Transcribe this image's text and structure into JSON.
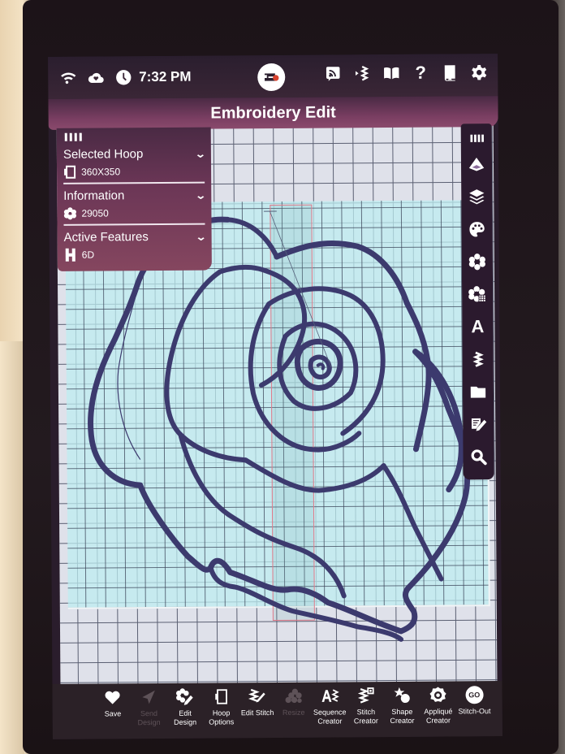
{
  "status_bar": {
    "time": "7:32 PM",
    "left_icons": [
      "wifi-icon",
      "cloud-heart-icon",
      "clock-icon"
    ],
    "center_icon": "sewing-machine-logo-icon",
    "right_icons": [
      "rss-feed-icon",
      "bluetooth-stitch-icon",
      "open-book-icon",
      "help-icon",
      "manual-book-icon",
      "settings-gear-icon"
    ],
    "help_glyph": "?"
  },
  "title_bar": {
    "title": "Embroidery Edit"
  },
  "info_panel": {
    "sections": [
      {
        "title": "Selected Hoop",
        "icon": "hoop-icon",
        "value": "360X350"
      },
      {
        "title": "Information",
        "icon": "flower-stitch-icon",
        "value": "29050"
      },
      {
        "title": "Active Features",
        "icon": "feature-h-icon",
        "value": "6D"
      }
    ],
    "chevron": "⌄"
  },
  "right_toolbar": {
    "items": [
      {
        "name": "grip-handle",
        "icon": "grip-icon"
      },
      {
        "name": "hoop-view",
        "icon": "pyramid-hoop-icon"
      },
      {
        "name": "layers",
        "icon": "layers-icon"
      },
      {
        "name": "color",
        "icon": "palette-icon"
      },
      {
        "name": "design",
        "icon": "flower-icon"
      },
      {
        "name": "design-library",
        "icon": "flower-grid-icon"
      },
      {
        "name": "font",
        "icon": "letter-a-icon",
        "glyph": "A"
      },
      {
        "name": "stitch",
        "icon": "zigzag-icon"
      },
      {
        "name": "file",
        "icon": "folder-icon"
      },
      {
        "name": "edit-notes",
        "icon": "pencil-note-icon"
      },
      {
        "name": "zoom",
        "icon": "magnifier-icon"
      }
    ]
  },
  "bottom_bar": {
    "items": [
      {
        "label": "Save",
        "icon": "heart-icon",
        "enabled": true
      },
      {
        "label": "Send Design",
        "icon": "send-icon",
        "enabled": false
      },
      {
        "label": "Edit Design",
        "icon": "edit-design-icon",
        "enabled": true
      },
      {
        "label": "Hoop Options",
        "icon": "hoop-options-icon",
        "enabled": true
      },
      {
        "label": "Edit Stitch",
        "icon": "edit-stitch-icon",
        "enabled": true
      },
      {
        "label": "Resize",
        "icon": "resize-icon",
        "enabled": false
      },
      {
        "label": "Sequence Creator",
        "icon": "sequence-creator-icon",
        "enabled": true
      },
      {
        "label": "Stitch Creator",
        "icon": "stitch-creator-icon",
        "enabled": true
      },
      {
        "label": "Shape Creator",
        "icon": "shape-creator-icon",
        "enabled": true
      },
      {
        "label": "Appliqué Creator",
        "icon": "applique-creator-icon",
        "enabled": true
      },
      {
        "label": "Stitch-Out",
        "icon": "go-icon",
        "glyph": "GO",
        "enabled": true
      }
    ]
  },
  "colors": {
    "title_bar": "#7a3e62",
    "panel": "#6b3656",
    "toolbar": "#2b1a2e",
    "hoop_fill": "#beecf0",
    "grid_line": "#5a5f72",
    "stitch": "#3c3a6e",
    "selection_frame": "#e07a8a"
  }
}
